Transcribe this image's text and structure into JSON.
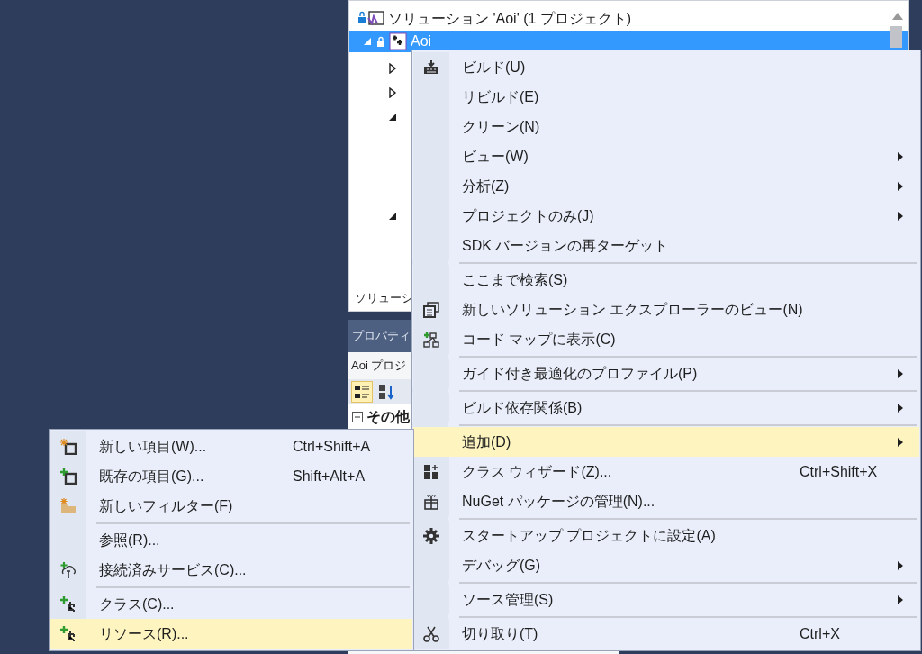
{
  "solution_explorer": {
    "root_label": "ソリューション 'Aoi' (1 プロジェクト)",
    "project": {
      "label": "Aoi",
      "selected": true,
      "expanded": true
    },
    "child_nodes": [
      {
        "expanded": false
      },
      {
        "expanded": false
      },
      {
        "expanded": true
      },
      {
        "expanded": true
      }
    ],
    "footer_tab": "ソリューシ"
  },
  "properties": {
    "title": "プロパティ",
    "object": "Aoi プロジ",
    "toolbar": [
      {
        "selected": true
      },
      {
        "selected": false
      }
    ],
    "category": "その他",
    "category_expanded": true
  },
  "context_menu": {
    "items": [
      {
        "kind": "item",
        "label": "ビルド(U)",
        "selected": false
      },
      {
        "kind": "item",
        "label": "リビルド(E)",
        "selected": false
      },
      {
        "kind": "item",
        "label": "クリーン(N)",
        "selected": false
      },
      {
        "kind": "item",
        "label": "ビュー(W)",
        "submenu": true,
        "selected": false
      },
      {
        "kind": "item",
        "label": "分析(Z)",
        "submenu": true,
        "selected": false
      },
      {
        "kind": "item",
        "label": "プロジェクトのみ(J)",
        "submenu": true,
        "selected": false
      },
      {
        "kind": "item",
        "label": "SDK バージョンの再ターゲット",
        "selected": false
      },
      {
        "kind": "separator"
      },
      {
        "kind": "item",
        "label": "ここまで検索(S)",
        "selected": false
      },
      {
        "kind": "item",
        "label": "新しいソリューション エクスプローラーのビュー(N)",
        "selected": false
      },
      {
        "kind": "item",
        "label": "コード マップに表示(C)",
        "selected": false
      },
      {
        "kind": "separator"
      },
      {
        "kind": "item",
        "label": "ガイド付き最適化のプロファイル(P)",
        "submenu": true,
        "selected": false
      },
      {
        "kind": "separator"
      },
      {
        "kind": "item",
        "label": "ビルド依存関係(B)",
        "submenu": true,
        "selected": false
      },
      {
        "kind": "separator"
      },
      {
        "kind": "item",
        "label": "追加(D)",
        "submenu": true,
        "selected": true
      },
      {
        "kind": "item",
        "label": "クラス ウィザード(Z)...",
        "shortcut": "Ctrl+Shift+X",
        "selected": false
      },
      {
        "kind": "item",
        "label": "NuGet パッケージの管理(N)...",
        "selected": false
      },
      {
        "kind": "separator"
      },
      {
        "kind": "item",
        "label": "スタートアップ プロジェクトに設定(A)",
        "selected": false
      },
      {
        "kind": "item",
        "label": "デバッグ(G)",
        "submenu": true,
        "selected": false
      },
      {
        "kind": "separator"
      },
      {
        "kind": "item",
        "label": "ソース管理(S)",
        "submenu": true,
        "selected": false
      },
      {
        "kind": "separator"
      },
      {
        "kind": "item",
        "label": "切り取り(T)",
        "shortcut": "Ctrl+X",
        "selected": false
      }
    ]
  },
  "add_submenu": {
    "items": [
      {
        "kind": "item",
        "label": "新しい項目(W)...",
        "shortcut": "Ctrl+Shift+A",
        "selected": false
      },
      {
        "kind": "item",
        "label": "既存の項目(G)...",
        "shortcut": "Shift+Alt+A",
        "selected": false
      },
      {
        "kind": "item",
        "label": "新しいフィルター(F)",
        "selected": false
      },
      {
        "kind": "separator"
      },
      {
        "kind": "item",
        "label": "参照(R)...",
        "selected": false
      },
      {
        "kind": "item",
        "label": "接続済みサービス(C)...",
        "selected": false
      },
      {
        "kind": "separator"
      },
      {
        "kind": "item",
        "label": "クラス(C)...",
        "selected": false
      },
      {
        "kind": "item",
        "label": "リソース(R)...",
        "selected": true
      }
    ]
  }
}
